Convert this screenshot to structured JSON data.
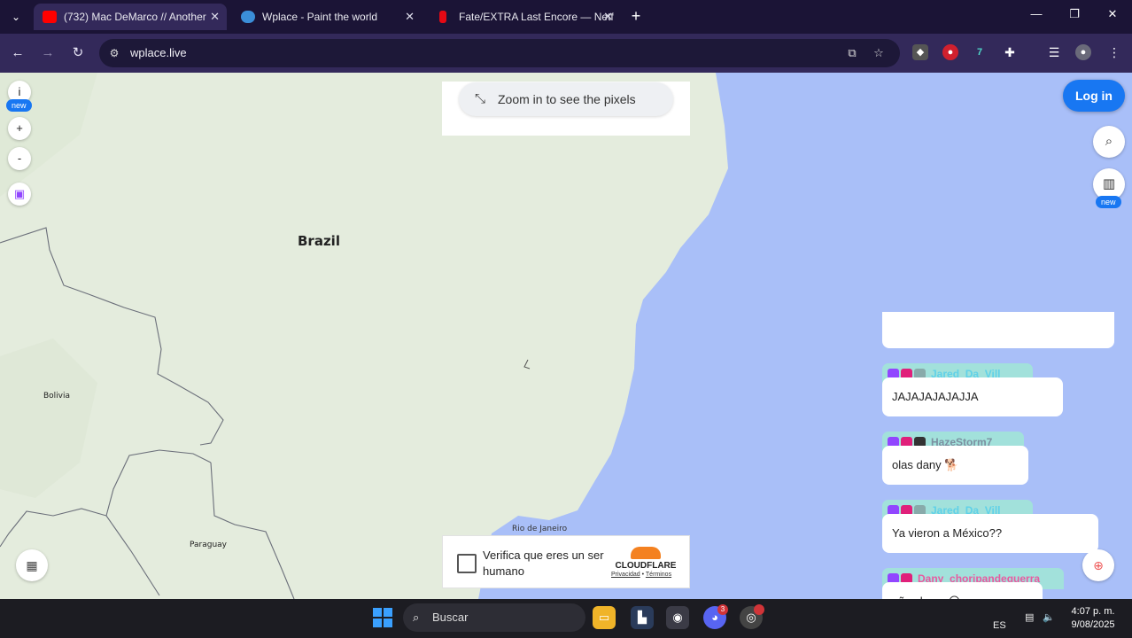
{
  "browser": {
    "tabs": [
      {
        "title": "(732) Mac DeMarco // Another",
        "favicon": "youtube-icon",
        "active": true
      },
      {
        "title": "Wplace - Paint the world",
        "favicon": "globe-icon",
        "active": false
      },
      {
        "title": "Fate/EXTRA Last Encore — Netf",
        "favicon": "netflix-icon",
        "active": false
      }
    ],
    "url": "wplace.live"
  },
  "map": {
    "labels": {
      "brazil": "Brazil",
      "bolivia": "Bolivia",
      "paraguay": "Paraguay",
      "rio": "Rio de Janeiro"
    },
    "zoom_hint": "Zoom in to see the pixels",
    "info_button": "i",
    "zoom_in": "+",
    "zoom_out": "-",
    "new_badge": "new",
    "login_label": "Log in",
    "colors": {
      "ocean": "#a9bff8",
      "land": "#e4ecdd",
      "accent": "#1877f2"
    }
  },
  "captcha": {
    "text": "Verifica que eres un ser humano",
    "brand": "CLOUDFLARE",
    "privacy": "Privacidad",
    "terms": "Términos"
  },
  "chat": [
    {
      "user": "Jared_Da_Vill",
      "user_color": "#5fd1e8",
      "message": "JAJAJAJAJAJJA"
    },
    {
      "user": "HazeStorm7",
      "user_color": "#7b8fa0",
      "message": "olas dany 🐕"
    },
    {
      "user": "Jared_Da_Vill",
      "user_color": "#5fd1e8",
      "message": "Ya vieron a México??"
    },
    {
      "user": "Dany_choripandeguerra",
      "user_color": "#e85aa0",
      "message": "oñas haze 😏"
    }
  ],
  "taskbar": {
    "search_placeholder": "Buscar",
    "discord_badge": "3",
    "lang": "ES",
    "time": "4:07 p. m.",
    "date": "9/08/2025"
  }
}
